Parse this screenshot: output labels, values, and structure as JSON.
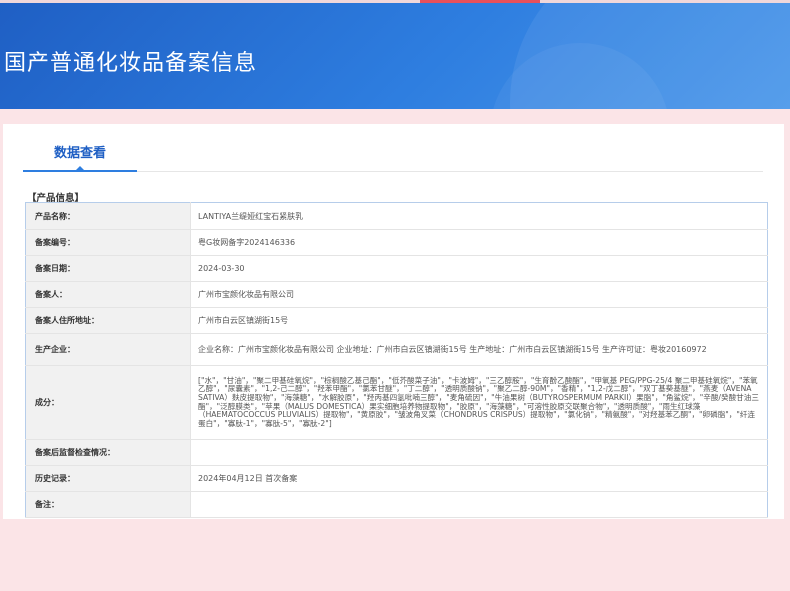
{
  "page": {
    "banner_title": "国产普通化妆品备案信息",
    "tab_label": "数据查看",
    "section_title": "【产品信息】"
  },
  "rows": [
    {
      "label": "产品名称：",
      "value": "LANTIYA兰缇娅红宝石紧肤乳"
    },
    {
      "label": "备案编号：",
      "value": "粤G妆网备字2024146336"
    },
    {
      "label": "备案日期：",
      "value": "2024-03-30"
    },
    {
      "label": "备案人：",
      "value": "广州市宝颜化妆品有限公司"
    },
    {
      "label": "备案人住所地址：",
      "value": "广州市白云区镇湖街15号"
    },
    {
      "label": "生产企业：",
      "value": "企业名称：广州市宝颜化妆品有限公司 企业地址：广州市白云区镇湖街15号 生产地址：广州市白云区镇湖街15号 生产许可证：粤妆20160972"
    },
    {
      "label": "成分：",
      "value": "[\"水\"，\"甘油\"，\"聚二甲基硅氧烷\"，\"棕榈酸乙基己酯\"，\"低芥酸菜子油\"，\"卡波姆\"，\"三乙醇胺\"，\"生育酚乙酸酯\"，\"甲氧基 PEG/PPG-25/4 聚二甲基硅氧烷\"，\"苯氧乙醇\"，\"尿囊素\"，\"1,2-己二醇\"，\"羟苯甲酯\"，\"氯苯甘醚\"，\"丁二醇\"，\"透明质酸钠\"，\"聚乙二醇-90M\"，\"香精\"，\"1,2-戊二醇\"，\"双丁基葵基醚\"，\"燕麦（AVENA SATIVA）麸皮提取物\"，\"海藻糖\"，\"水解胶原\"，\"羟丙基四氢吡喃三醇\"，\"麦角硫因\"，\"牛油果树（BUTYROSPERMUM PARKII）果脂\"，\"角鲨烷\"，\"辛酸/癸酸甘油三酯\"，\"泛醇膜类\"，\"苹果（MALUS DOMESTICA）果实细胞培养物提取物\"，\"胶原\"，\"海藻糖\"，\"可溶性胶原交联聚合物\"，\"透明质酸\"，\"雨生红球藻（HAEMATOCOCCUS PLUVIALIS）提取物\"，\"黄原胶\"，\"皱波角叉菜（CHONDRUS CRISPUS）提取物\"，\"氯化钠\"，\"精氨酸\"，\"对羟基苯乙酮\"，\"卵磷脂\"，\"纤连蛋白\"，\"寡肽-1\"，\"寡肽-5\"，\"寡肽-2\"]"
    },
    {
      "label": "备案后监督检查情况：",
      "value": ""
    },
    {
      "label": "历史记录：",
      "value": "2024年04月12日 首次备案"
    },
    {
      "label": "备注：",
      "value": ""
    }
  ]
}
